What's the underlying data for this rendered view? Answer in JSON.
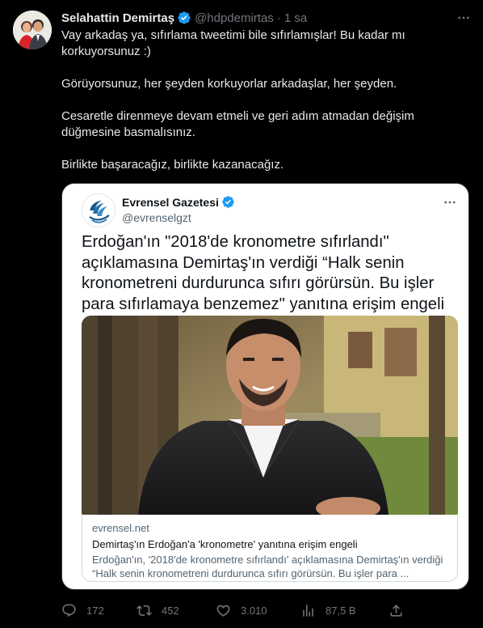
{
  "tweet": {
    "author": {
      "name": "Selahattin Demirtaş",
      "handle": "@hdpdemirtas",
      "separator": "·",
      "time": "1 sa"
    },
    "paragraphs": [
      "Vay arkadaş ya, sıfırlama tweetimi bile sıfırlamışlar! Bu kadar mı korkuyorsunuz :)",
      "Görüyorsunuz, her şeyden korkuyorlar arkadaşlar, her şeyden.",
      "Cesaretle direnmeye devam etmeli ve geri adım atmadan değişim düğmesine basmalısınız.",
      "Birlikte başaracağız, birlikte kazanacağız."
    ],
    "quoted": {
      "name": "Evrensel Gazetesi",
      "handle": "@evrenselgzt",
      "headline": "Erdoğan'ın \"2018'de kronometre sıfırlandı\" açıklamasına Demirtaş'ın verdiği “Halk senin kronometreni durdurunca sıfırı görürsün. Bu işler para sıfırlamaya benzemez\" yanıtına erişim engeli getirildi",
      "link": {
        "domain": "evrensel.net",
        "title": "Demirtaş'ın Erdoğan'a 'kronometre' yanıtına erişim engeli",
        "description": "Erdoğan'ın, '2018'de kronometre sıfırlandı' açıklamasına Demirtaş'ın verdiği “Halk senin kronometreni durdurunca sıfırı görürsün. Bu işler para ..."
      }
    },
    "actions": {
      "replies": "172",
      "retweets": "452",
      "likes": "3.010",
      "views": "87,5 B"
    }
  },
  "icons": {
    "verified": "verified-badge-icon",
    "more": "more-icon",
    "reply": "reply-icon",
    "retweet": "retweet-icon",
    "like": "heart-icon",
    "views": "views-icon",
    "share": "share-icon"
  },
  "colors": {
    "background": "#000000",
    "text": "#e7e9ea",
    "muted": "#71767b",
    "verified": "#1d9bf0",
    "card_background": "#ffffff"
  }
}
